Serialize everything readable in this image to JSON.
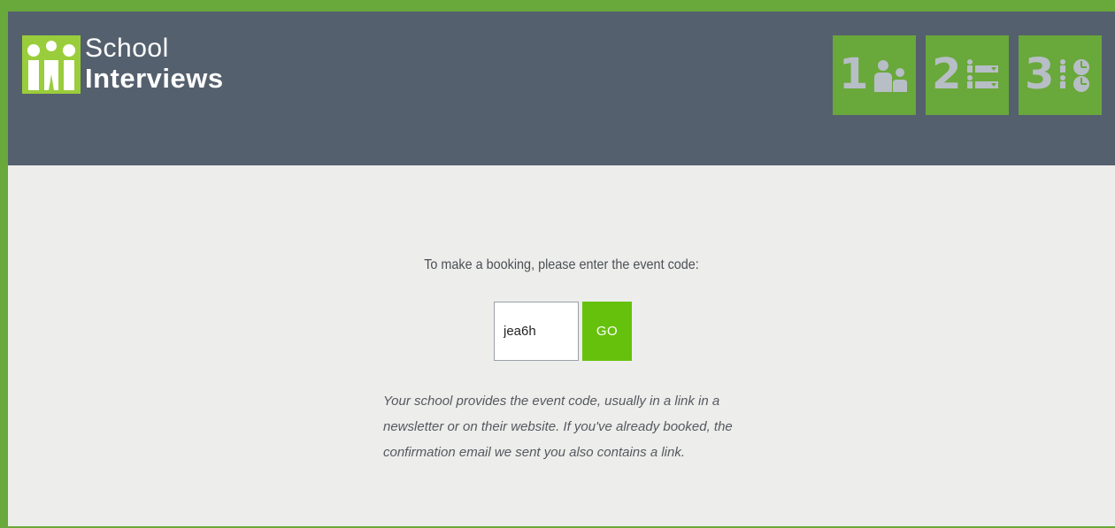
{
  "brand": {
    "name_line1": "School",
    "name_line2": "Interviews",
    "primary_color": "#69a83a",
    "header_color": "#55606e",
    "button_color": "#66c10c"
  },
  "steps": [
    {
      "number": "1",
      "icon": "people-icon"
    },
    {
      "number": "2",
      "icon": "list-icon"
    },
    {
      "number": "3",
      "icon": "schedule-icon"
    }
  ],
  "booking": {
    "prompt": "To make a booking, please enter the event code:",
    "code_value": "jea6h",
    "go_label": "GO",
    "help_lines": [
      "Your school provides the event code, usually in a link in a",
      "newsletter or on their website. If you've already booked, the",
      "confirmation email we sent you also contains a link."
    ]
  }
}
